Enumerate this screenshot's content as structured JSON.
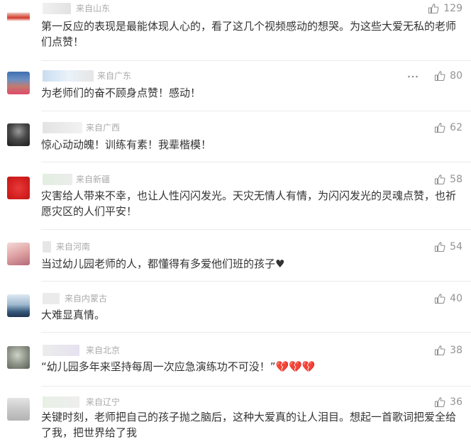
{
  "icons": {
    "like": "thumbs-up-icon",
    "more": "more-dots-icon"
  },
  "colors": {
    "like_icon": "#8f8f8f",
    "location_text": "#aaaaaa",
    "comment_text": "#333333",
    "like_count": "#939393"
  },
  "comments": [
    {
      "location": "来自山东",
      "likes": "129",
      "text": "第一反应的表现是最能体现人心的，看了这几个视频感动的想哭。为这些大爱无私的老师们点赞！"
    },
    {
      "location": "来自广东",
      "likes": "80",
      "text": "为老师们的奋不顾身点赞！感动！",
      "more_icon": "more-dots-icon"
    },
    {
      "location": "来自广西",
      "likes": "62",
      "text": "惊心动动魄！训练有素！我辈楷模！"
    },
    {
      "location": "来自新疆",
      "likes": "58",
      "text": "灾害给人带来不幸，也让人性闪闪发光。天灾无情人有情，为闪闪发光的灵魂点赞，也祈愿灾区的人们平安！"
    },
    {
      "location": "来自河南",
      "likes": "54",
      "text": "当过幼儿园老师的人，都懂得有多爱他们班的孩子♥"
    },
    {
      "location": "来自内蒙古",
      "likes": "40",
      "text": "大难显真情。"
    },
    {
      "location": "来自北京",
      "likes": "38",
      "text": "“幼儿园多年来坚持每周一次应急演练功不可没！”💔💔💔"
    },
    {
      "location": "来自辽宁",
      "likes": "36",
      "text": "关键时刻，老师把自己的孩子抛之脑后，这种大爱真的让人泪目。想起一首歌词把爱全给了我，把世界给了我"
    }
  ]
}
